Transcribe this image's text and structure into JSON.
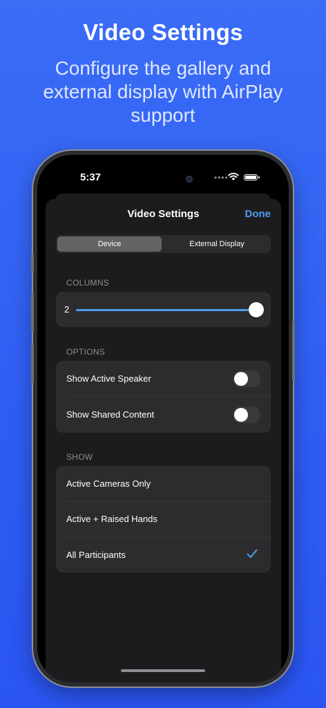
{
  "promo": {
    "title": "Video Settings",
    "subtitle": "Configure the gallery and external display with AirPlay support"
  },
  "status_bar": {
    "time": "5:37"
  },
  "sheet": {
    "title": "Video Settings",
    "done_label": "Done",
    "segments": [
      {
        "label": "Device",
        "selected": true
      },
      {
        "label": "External Display",
        "selected": false
      }
    ]
  },
  "columns": {
    "header": "COLUMNS",
    "value": "2",
    "slider_fraction": 1.0
  },
  "options": {
    "header": "OPTIONS",
    "items": [
      {
        "label": "Show Active Speaker",
        "enabled": false
      },
      {
        "label": "Show Shared Content",
        "enabled": false
      }
    ]
  },
  "show": {
    "header": "SHOW",
    "items": [
      {
        "label": "Active Cameras Only",
        "selected": false
      },
      {
        "label": "Active + Raised Hands",
        "selected": false
      },
      {
        "label": "All Participants",
        "selected": true
      }
    ]
  },
  "colors": {
    "background": "#2f5ef3",
    "accent": "#4b9ef0",
    "sheet": "#1c1c1e",
    "group": "#2c2c2e"
  }
}
